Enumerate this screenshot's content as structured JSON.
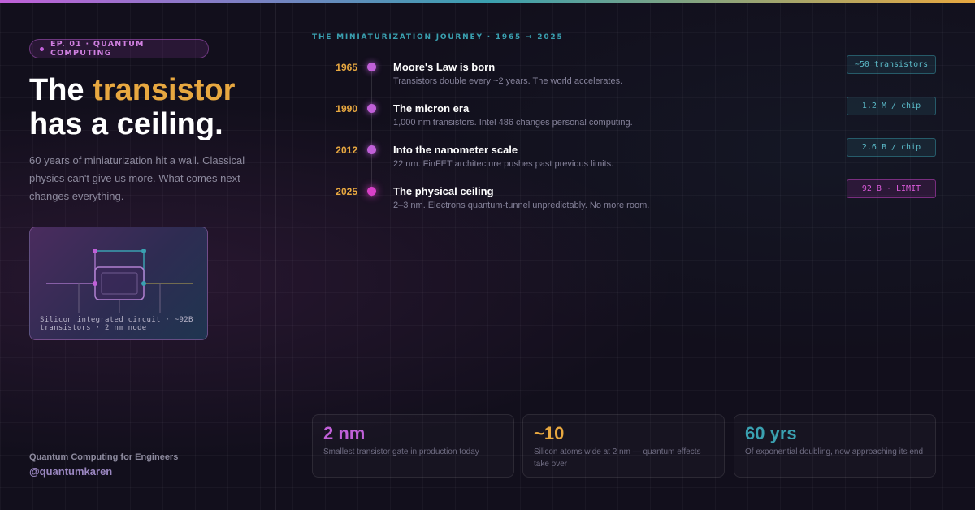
{
  "badge": {
    "label": "EP. 01 · QUANTUM COMPUTING"
  },
  "headline": {
    "line1_prefix": "The ",
    "line1_accent": "transistor",
    "line2": "has a ceiling."
  },
  "intro": "60 years of miniaturization hit a wall. Classical physics can't give us more. What comes next changes everything.",
  "circuit_card": {
    "caption": "Silicon integrated circuit · ~92B transistors · 2 nm node"
  },
  "footer": {
    "series": "Quantum Computing for Engineers",
    "handle": "@quantumkaren"
  },
  "journey": {
    "title": "THE MINIATURIZATION JOURNEY · 1965 → 2025",
    "items": [
      {
        "year": "1965",
        "title": "Moore's Law is born",
        "desc": "Transistors double every ~2 years. The world accelerates.",
        "tag": "~50 transistors"
      },
      {
        "year": "1990",
        "title": "The micron era",
        "desc": "1,000 nm transistors. Intel 486 changes personal computing.",
        "tag": "1.2 M / chip"
      },
      {
        "year": "2012",
        "title": "Into the nanometer scale",
        "desc": "22 nm. FinFET architecture pushes past previous limits.",
        "tag": "2.6 B / chip"
      },
      {
        "year": "2025",
        "title": "The physical ceiling",
        "desc": "2–3 nm. Electrons quantum-tunnel unpredictably. No more room.",
        "tag": "92 B · LIMIT"
      }
    ]
  },
  "stats": [
    {
      "value": "2 nm",
      "label": "Smallest transistor gate in production today",
      "color": "#c060d8"
    },
    {
      "value": "~10",
      "label": "Silicon atoms wide at 2 nm — quantum effects take over",
      "color": "#e8a840"
    },
    {
      "value": "60 yrs",
      "label": "Of exponential doubling, now approaching its end",
      "color": "#3aa0b0"
    }
  ],
  "colors": {
    "purple": "#c060d8",
    "amber": "#e8a840",
    "teal": "#3aa0b0",
    "background": "#120f1c"
  }
}
